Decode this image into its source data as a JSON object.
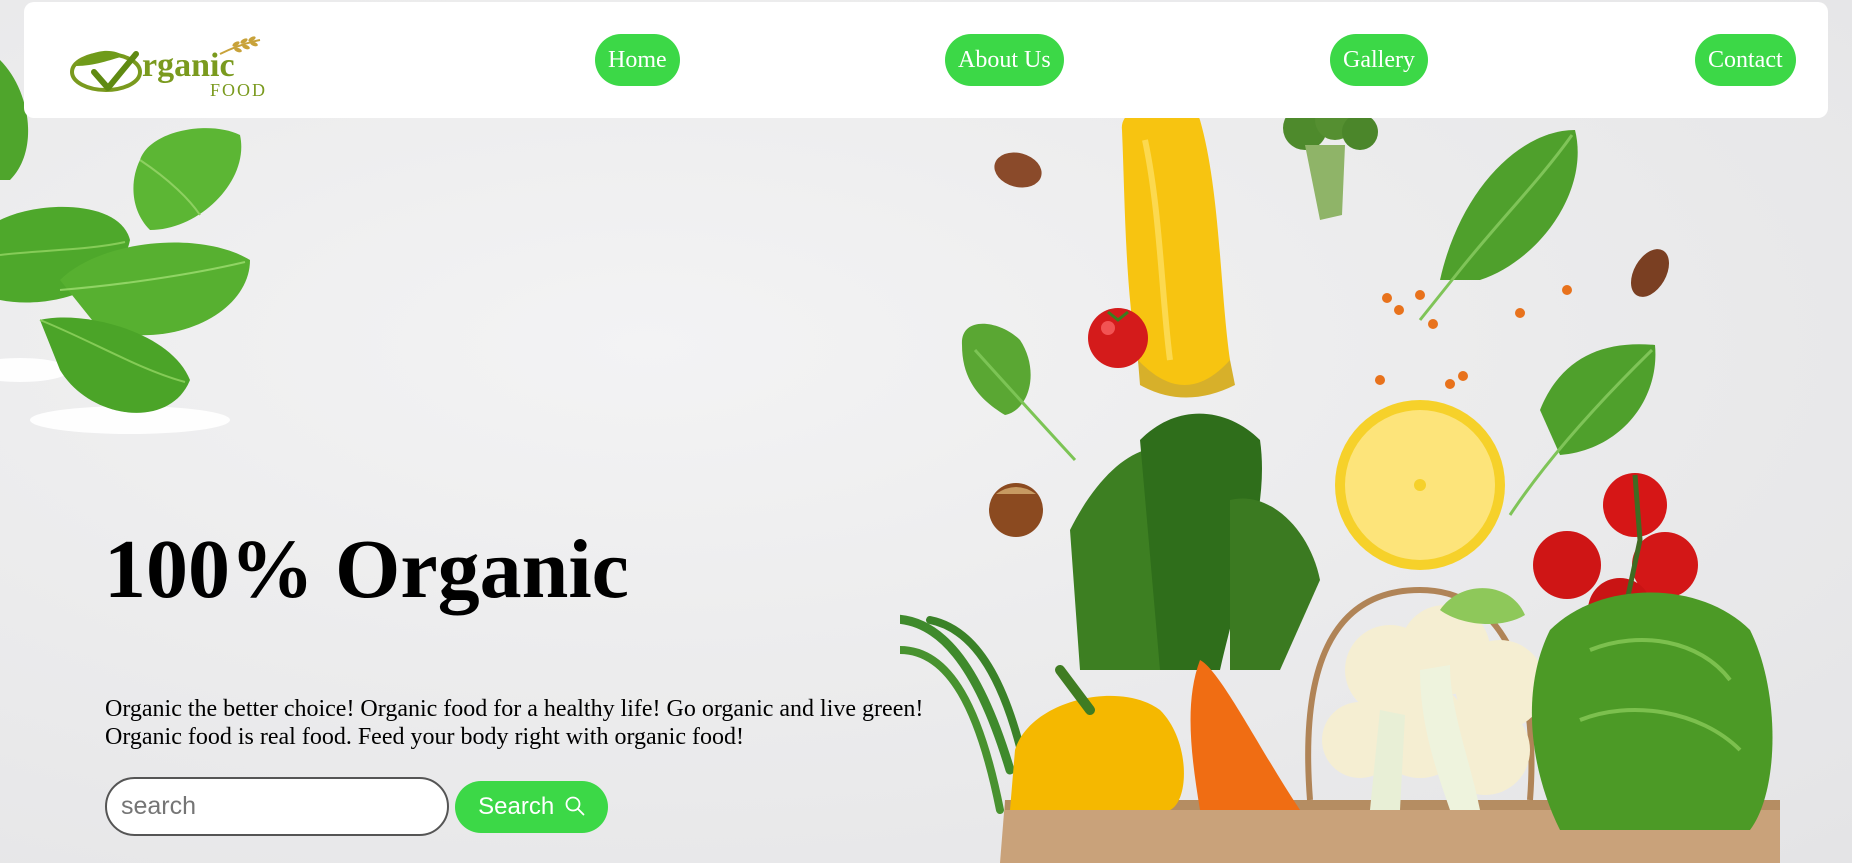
{
  "header": {
    "logo": {
      "word": "rganic",
      "sub": "FOOD",
      "color": "#7a9a1e",
      "accent": "#c8a23a"
    },
    "nav": [
      {
        "label": "Home"
      },
      {
        "label": "About Us"
      },
      {
        "label": "Gallery"
      },
      {
        "label": "Contact"
      }
    ]
  },
  "hero": {
    "title": "100% Organic",
    "description_line1": "Organic the better choice! Organic food for a healthy life! Go organic and live green!",
    "description_line2": "Organic food is real food. Feed your body right with organic food!"
  },
  "search": {
    "placeholder": "search",
    "value": "",
    "button_label": "Search",
    "button_icon": "magnifier-icon"
  },
  "colors": {
    "accent_green": "#3cd847",
    "background": "#ececed",
    "text": "#000000"
  }
}
